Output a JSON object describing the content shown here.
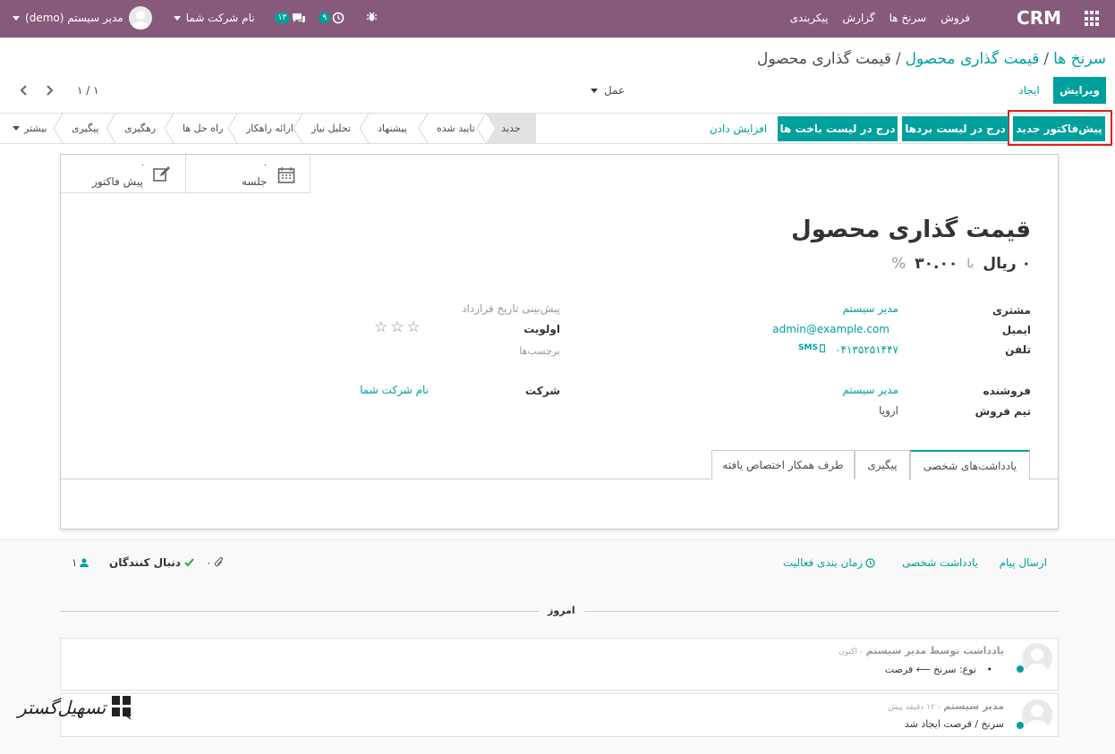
{
  "nav": {
    "brand": "CRM",
    "menu": [
      "فروش",
      "سرنخ ها",
      "گزارش",
      "پیکربندی"
    ],
    "user": "مدیر سیستم (demo)",
    "company": "نام شرکت شما",
    "messages_count": "۱۳",
    "activities_count": "۹"
  },
  "breadcrumb": {
    "parent1": "سرنخ ها",
    "parent2": "قیمت گذاری محصول",
    "current": "قیمت گذاری محصول",
    "sep": "/"
  },
  "controls": {
    "edit": "ویرایش",
    "create": "ایجاد",
    "action": "عمل",
    "pager": "۱ / ۱"
  },
  "header_buttons": {
    "new_quote": "پیش‌فاکتور جدید",
    "mark_won": "درج در لیست بردها",
    "mark_lost": "درج در لیست باخت ها",
    "enrich": "افزایش دادن"
  },
  "stages": [
    "جدید",
    "تایید شده",
    "پیشنهاد",
    "تحلیل نیاز",
    "ارائه راهکار",
    "راه حل ها",
    "رهگیری",
    "پیگیری",
    "بیشتر"
  ],
  "smart_buttons": [
    {
      "label": "جلسه",
      "count": "۰",
      "icon": "calendar-icon"
    },
    {
      "label": "پیش فاکتور",
      "count": "۰",
      "icon": "edit-icon"
    }
  ],
  "record": {
    "title": "قیمت گذاری محصول",
    "revenue": "۰ ریال",
    "at": "با",
    "probability": "۳۰.۰۰",
    "percent": "%"
  },
  "fields_left": {
    "customer_label": "مشتری",
    "customer": "مدیر سیستم",
    "email_label": "ایمیل",
    "email": "admin@example.com",
    "phone_label": "تلفن",
    "phone": "۰۴۱۳۵۲۵۱۴۴۷",
    "sms": "SMS",
    "salesperson_label": "فروشنده",
    "salesperson": "مدیر سیستم",
    "team_label": "تیم فروش",
    "team": "اروپا"
  },
  "fields_right": {
    "expected_closing_label": "پیش‌بینی تاریخ قرارداد",
    "priority_label": "اولویت",
    "tags_label": "برچسب‌ها",
    "company_label": "شرکت",
    "company": "نام شرکت شما"
  },
  "tabs": [
    "یادداشت‌های شخصی",
    "پیگیری",
    "طرف همکار اختصاص یافته"
  ],
  "chatter": {
    "send_message": "ارسال پیام",
    "log_note": "یادداشت شخصی",
    "schedule_activity": "زمان بندی فعالیت",
    "attachments": "۰",
    "followers_label": "دنبال کنندگان",
    "followers_count": "۱",
    "date_separator": "امروز",
    "messages": [
      {
        "head_prefix": "یادداشت توسط",
        "author": "مدیر سیستم",
        "time": "- اکنون",
        "body": "نوع: سرنخ ⟵ فرصت"
      },
      {
        "head_prefix": "",
        "author": "مدیر سیستم",
        "time": "- ۱۲ دقیقه پیش",
        "body": "سرنخ / فرصت ایجاد شد"
      }
    ]
  },
  "watermark": "تسهیل‌گستر",
  "colors": {
    "nav": "#875a7b",
    "primary": "#00a09d",
    "highlight": "#e02020"
  }
}
